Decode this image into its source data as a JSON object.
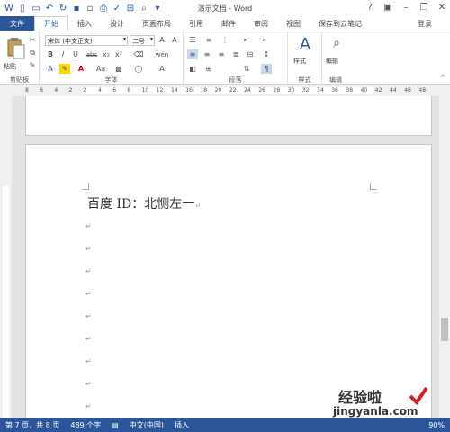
{
  "window": {
    "title": "演示文档 - Word",
    "login": "登录"
  },
  "tabs": {
    "file": "文件",
    "items": [
      "开始",
      "插入",
      "设计",
      "页面布局",
      "引用",
      "邮件",
      "审阅",
      "视图",
      "保存到云笔记"
    ],
    "active": "开始"
  },
  "ribbon": {
    "clipboard_label": "剪贴板",
    "paste_label": "粘贴",
    "font_label": "字体",
    "paragraph_label": "段落",
    "styles_label": "样式",
    "editing_label": "编辑",
    "style_button": "样式",
    "edit_button": "编辑",
    "font_name": "宋体 (中文正文)",
    "font_size": "二号",
    "bold": "B",
    "italic": "I",
    "underline": "U",
    "strike": "abc",
    "subscript": "x₂",
    "superscript": "x²",
    "font_color_a": "A",
    "change_case": "Aa",
    "wen": "wén",
    "ruby_a": "A"
  },
  "ruler": {
    "numbers": [
      "8",
      "6",
      "4",
      "2",
      "2",
      "4",
      "6",
      "8",
      "10",
      "12",
      "14",
      "16",
      "18",
      "20",
      "22",
      "24",
      "26",
      "28",
      "30",
      "32",
      "34",
      "36",
      "38",
      "40",
      "42",
      "44",
      "46",
      "48"
    ]
  },
  "document": {
    "heading": "百度 ID：北恻左一",
    "paragraph_mark": "↵"
  },
  "statusbar": {
    "page": "第 7 页，共 8 页",
    "words": "489 个字",
    "language": "中文(中国)",
    "mode": "插入",
    "zoom": "90%"
  },
  "watermark": {
    "line1": "经验啦",
    "line2": "jingyanla.com"
  },
  "colors": {
    "accent": "#2b579a",
    "font_color_red": "#e00000",
    "highlight_yellow": "#ffd800"
  }
}
